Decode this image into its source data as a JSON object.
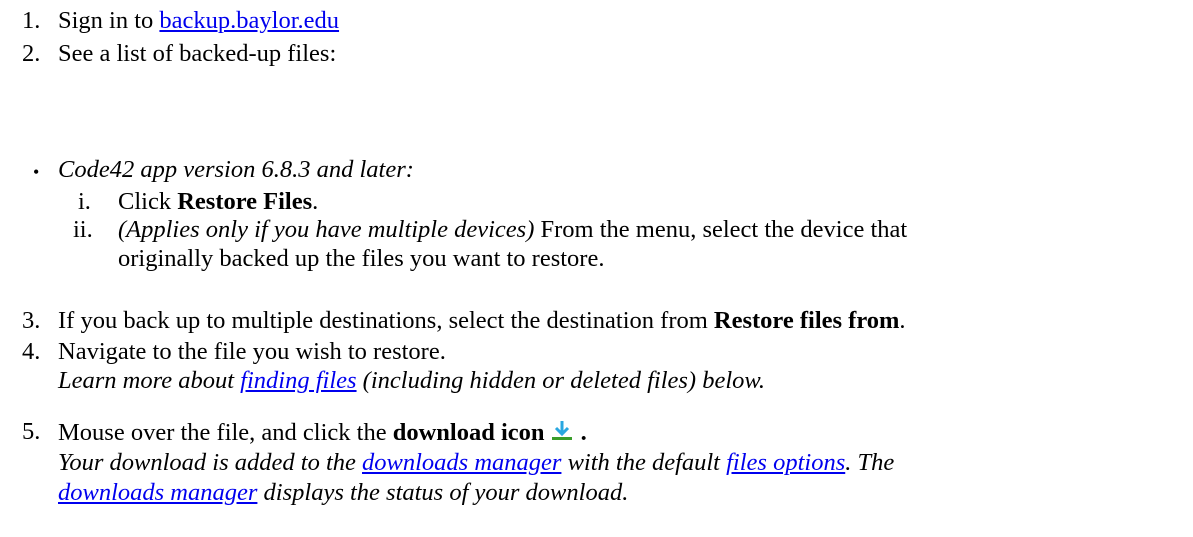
{
  "steps": {
    "s1": {
      "num": "1.",
      "pre": "Sign in to ",
      "link": "backup.baylor.edu"
    },
    "s2": {
      "num": "2.",
      "text": "See a list of backed-up files:"
    },
    "bullet": {
      "glyph": "•",
      "text": "Code42 app version 6.8.3 and later:"
    },
    "sub_i": {
      "num": "i.",
      "pre": "Click ",
      "bold": "Restore Files",
      "post": "."
    },
    "sub_ii": {
      "num": "ii.",
      "italic": "(Applies only if you have multiple devices)",
      "line1": " From the menu, select the device that",
      "line2": "originally backed up the files you want to restore."
    },
    "s3": {
      "num": "3.",
      "pre": "If you back up to multiple destinations, select the destination from ",
      "bold": "Restore files from",
      "post": "."
    },
    "s4": {
      "num": "4.",
      "text": "Navigate to the file you wish to restore.",
      "note_pre": "Learn more about ",
      "note_link": "finding files",
      "note_post": " (including hidden or deleted files) below."
    },
    "s5": {
      "num": "5.",
      "pre": "Mouse over the file, and click the ",
      "bold": "download icon",
      "post_bold": " .",
      "note1_pre": "Your download is added to the ",
      "note1_link1": "downloads manager",
      "note1_mid": " with the default ",
      "note1_link2": "files options",
      "note1_post": ". The",
      "note2_link": "downloads manager",
      "note2_post": " displays the status of your download."
    }
  },
  "icons": {
    "download": "download-icon"
  },
  "colors": {
    "link": "#0000ee",
    "icon_arrow": "#2aa7e0",
    "icon_bar": "#3a9d2a"
  }
}
